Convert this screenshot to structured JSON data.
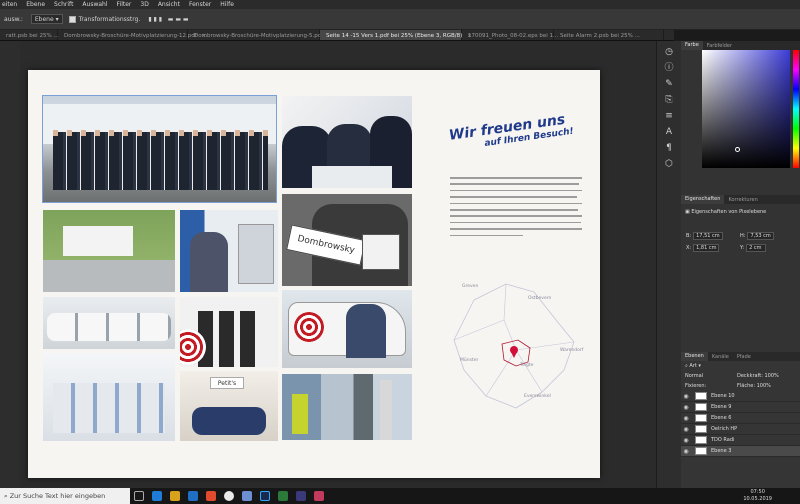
{
  "menubar": {
    "items": [
      "eiten",
      "Ebene",
      "Schrift",
      "Auswahl",
      "Filter",
      "3D",
      "Ansicht",
      "Fenster",
      "Hilfe"
    ]
  },
  "options": {
    "mode_label": "ausw.:",
    "mode_value": "Ebene",
    "transform_label": "Transformationsstrg."
  },
  "tabs": [
    {
      "label": "ratt.psb bei 25% ...",
      "active": false
    },
    {
      "label": "Dombrowsky-Broschüre-Motivplatzierung-12.pdf",
      "active": false
    },
    {
      "label": "Dombrowsky-Broschüre-Motivplatzierung-5.pdf",
      "active": false
    },
    {
      "label": "Seite 14 -15 Vers 1.pdf bei 25% (Ebene 3, RGB/8)",
      "active": true
    },
    {
      "label": "170091_Photo_08-02.eps bei 1...",
      "active": false
    },
    {
      "label": "Seite Alarm 2.psb bei 25% ...",
      "active": false
    }
  ],
  "document": {
    "headline_1": "Wir freuen uns",
    "headline_2": "auf Ihren Besuch!",
    "sign_text": "Dombrowsky",
    "shop_sign": "Petit's",
    "map_labels": {
      "greven": "Greven",
      "ostbevern": "Ostbevern",
      "telgte": "Telgte",
      "muenster": "Münster",
      "warendorf": "Warendorf",
      "everswinkel": "Everswinkel"
    }
  },
  "right_panel": {
    "color_tabs": [
      "Farbe",
      "Farbfelder"
    ],
    "prop_tabs": [
      "Eigenschaften",
      "Korrekturen"
    ],
    "prop_title": "Eigenschaften von Pixelebene",
    "fields": {
      "b_label": "B:",
      "b_value": "17,51 cm",
      "h_label": "H:",
      "h_value": "7,53 cm",
      "x_label": "X:",
      "x_value": "1,81 cm",
      "y_label": "Y:",
      "y_value": "2 cm"
    },
    "layers_tabs": [
      "Ebenen",
      "Kanäle",
      "Pfade"
    ],
    "filter_label": "Art",
    "blend_mode": "Normal",
    "opacity_label": "Deckkraft:",
    "opacity_value": "100%",
    "lock_label": "Fixieren:",
    "fill_label": "Fläche:",
    "fill_value": "100%",
    "layers": [
      "Ebene 10",
      "Ebene 9",
      "Ebene 6",
      "Oelrich HP",
      "TDO Radi",
      "Ebene 3"
    ]
  },
  "taskbar": {
    "search_placeholder": "Zur Suche Text hier eingeben",
    "time": "07:50",
    "date": "10.05.2019"
  },
  "colors": {
    "headline": "#1f3a8a",
    "accent_pin": "#d0103a",
    "panel_bg": "#333333"
  }
}
